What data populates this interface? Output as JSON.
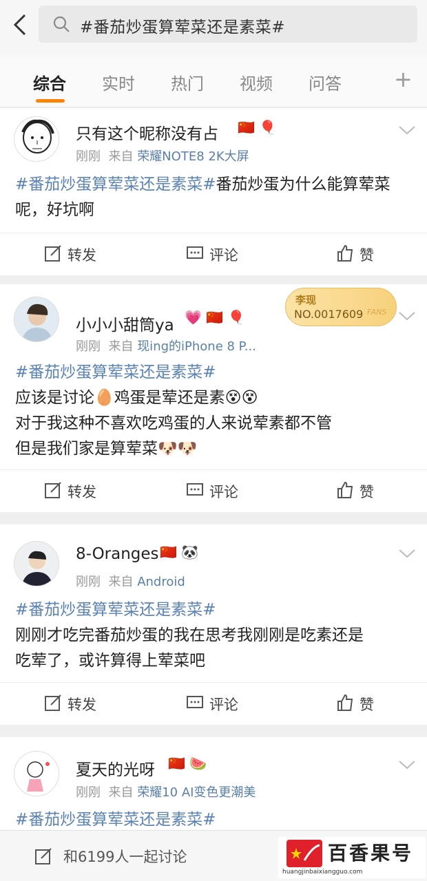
{
  "search": {
    "query": "#番茄炒蛋算荤菜还是素菜#"
  },
  "tabs": [
    {
      "label": "综合"
    },
    {
      "label": "实时"
    },
    {
      "label": "热门"
    },
    {
      "label": "视频"
    },
    {
      "label": "问答"
    }
  ],
  "tab_plus": "+",
  "posts": [
    {
      "username": "只有这个昵称没有占",
      "badges": "🇨🇳 🎈",
      "time": "刚刚",
      "from": "来自",
      "source": "荣耀NOTE8  2K大屏",
      "tag": "#番茄炒蛋算荤菜还是素菜#",
      "text": "番茄炒蛋为什么能算荤菜呢，好坑啊",
      "repost": "转发",
      "comment": "评论",
      "like": "赞"
    },
    {
      "username": "小小小甜筒ya",
      "badges": "💗 🇨🇳 🎈",
      "time": "刚刚",
      "from": "来自",
      "source": "现ing的iPhone 8 P...",
      "tag": "#番茄炒蛋算荤菜还是素菜#",
      "line1": "应该是讨论🥚鸡蛋是荤还是素😵😵",
      "line2": "对于我这种不喜欢吃鸡蛋的人来说荤素都不管",
      "line3": "但是我们家是算荤菜🐶🐶",
      "fans_name": "李现",
      "fans_no": "NO.0017609",
      "fans_label": "FANS",
      "repost": "转发",
      "comment": "评论",
      "like": "赞"
    },
    {
      "username": "8-Oranges",
      "badges": "🇨🇳 🐼",
      "time": "刚刚",
      "from": "来自",
      "source": "Android",
      "tag": "#番茄炒蛋算荤菜还是素菜#",
      "line1": "刚刚才吃完番茄炒蛋的我在思考我刚刚是吃素还是",
      "line2": "吃荤了，或许算得上荤菜吧",
      "repost": "转发",
      "comment": "评论",
      "like": "赞"
    },
    {
      "username": "夏天的光呀",
      "badges": "🇨🇳 🍉",
      "time": "刚刚",
      "from": "来自",
      "source": "荣耀10 AI变色更潮美",
      "tag": "#番茄炒蛋算荤菜还是素菜#"
    }
  ],
  "bottom": {
    "discuss": "和6199人一起讨论"
  },
  "watermark": {
    "name": "百香果号",
    "url": "huangjinbaixiangguo.com"
  },
  "colors": {
    "accent": "#ff8200",
    "topic": "#5b82b5",
    "source": "#5a7fa8"
  }
}
